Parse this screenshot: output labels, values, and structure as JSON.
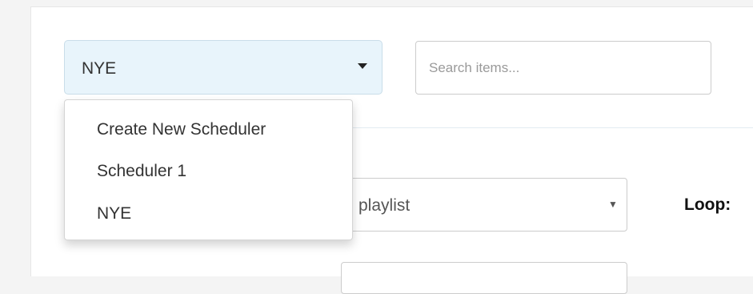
{
  "scheduler_select": {
    "selected": "NYE"
  },
  "search": {
    "placeholder": "Search items..."
  },
  "scheduler_menu": {
    "items": [
      {
        "label": "Create New Scheduler"
      },
      {
        "label": "Scheduler 1"
      },
      {
        "label": "NYE"
      }
    ]
  },
  "playlist_select": {
    "selected": "playlist"
  },
  "loop": {
    "label": "Loop:"
  }
}
